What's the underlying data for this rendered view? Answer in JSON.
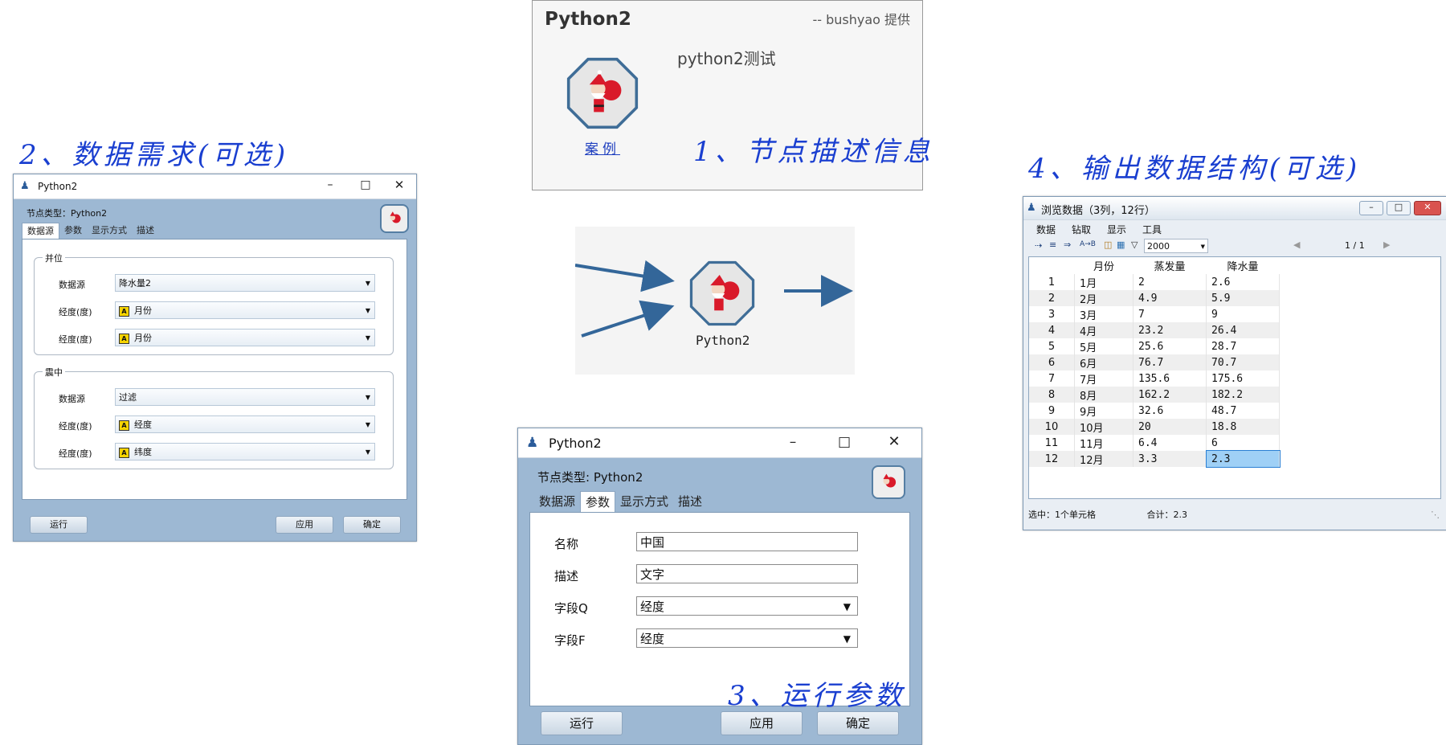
{
  "panel1": {
    "title": "Python2",
    "provider": "-- bushyao 提供",
    "description": "python2测试",
    "link": "案例",
    "heading": "1、节点描述信息"
  },
  "workflow": {
    "node_label": "Python2",
    "accent": "#336699"
  },
  "panel2": {
    "heading": "2、数据需求(可选)",
    "window_title": "Python2",
    "node_type": "节点类型：Python2",
    "tabs": [
      "数据源",
      "参数",
      "显示方式",
      "描述"
    ],
    "group1": {
      "label": "并位",
      "rows": [
        {
          "label": "数据源",
          "value": "降水量2",
          "has_a_icon": false
        },
        {
          "label": "经度(度)",
          "value": "月份",
          "has_a_icon": true
        },
        {
          "label": "经度(度)",
          "value": "月份",
          "has_a_icon": true
        }
      ]
    },
    "group2": {
      "label": "震中",
      "rows": [
        {
          "label": "数据源",
          "value": "过滤",
          "has_a_icon": false
        },
        {
          "label": "经度(度)",
          "value": "经度",
          "has_a_icon": true
        },
        {
          "label": "经度(度)",
          "value": "纬度",
          "has_a_icon": true
        }
      ]
    },
    "buttons": {
      "run": "运行",
      "apply": "应用",
      "ok": "确定"
    }
  },
  "panel3": {
    "heading": "3、运行参数",
    "window_title": "Python2",
    "node_type": "节点类型: Python2",
    "tabs": [
      "数据源",
      "参数",
      "显示方式",
      "描述"
    ],
    "fields": [
      {
        "label": "名称",
        "value": "中国"
      },
      {
        "label": "描述",
        "value": "文字"
      },
      {
        "label": "字段Q",
        "value": "经度"
      },
      {
        "label": "字段F",
        "value": "经度"
      }
    ],
    "buttons": {
      "run": "运行",
      "apply": "应用",
      "ok": "确定"
    }
  },
  "panel4": {
    "heading": "4、输出数据结构(可选)",
    "window_title": "浏览数据（3列，12行）",
    "menu": [
      "数据",
      "钻取",
      "显示",
      "工具"
    ],
    "toolbar": {
      "limit": "2000",
      "page": "1 / 1"
    },
    "columns": [
      "月份",
      "蒸发量",
      "降水量"
    ],
    "rows": [
      [
        "1",
        "1月",
        "2",
        "2.6"
      ],
      [
        "2",
        "2月",
        "4.9",
        "5.9"
      ],
      [
        "3",
        "3月",
        "7",
        "9"
      ],
      [
        "4",
        "4月",
        "23.2",
        "26.4"
      ],
      [
        "5",
        "5月",
        "25.6",
        "28.7"
      ],
      [
        "6",
        "6月",
        "76.7",
        "70.7"
      ],
      [
        "7",
        "7月",
        "135.6",
        "175.6"
      ],
      [
        "8",
        "8月",
        "162.2",
        "182.2"
      ],
      [
        "9",
        "9月",
        "32.6",
        "48.7"
      ],
      [
        "10",
        "10月",
        "20",
        "18.8"
      ],
      [
        "11",
        "11月",
        "6.4",
        "6"
      ],
      [
        "12",
        "12月",
        "3.3",
        "2.3"
      ]
    ],
    "status_selected": "选中：1个单元格",
    "status_total": "合计：2.3"
  }
}
